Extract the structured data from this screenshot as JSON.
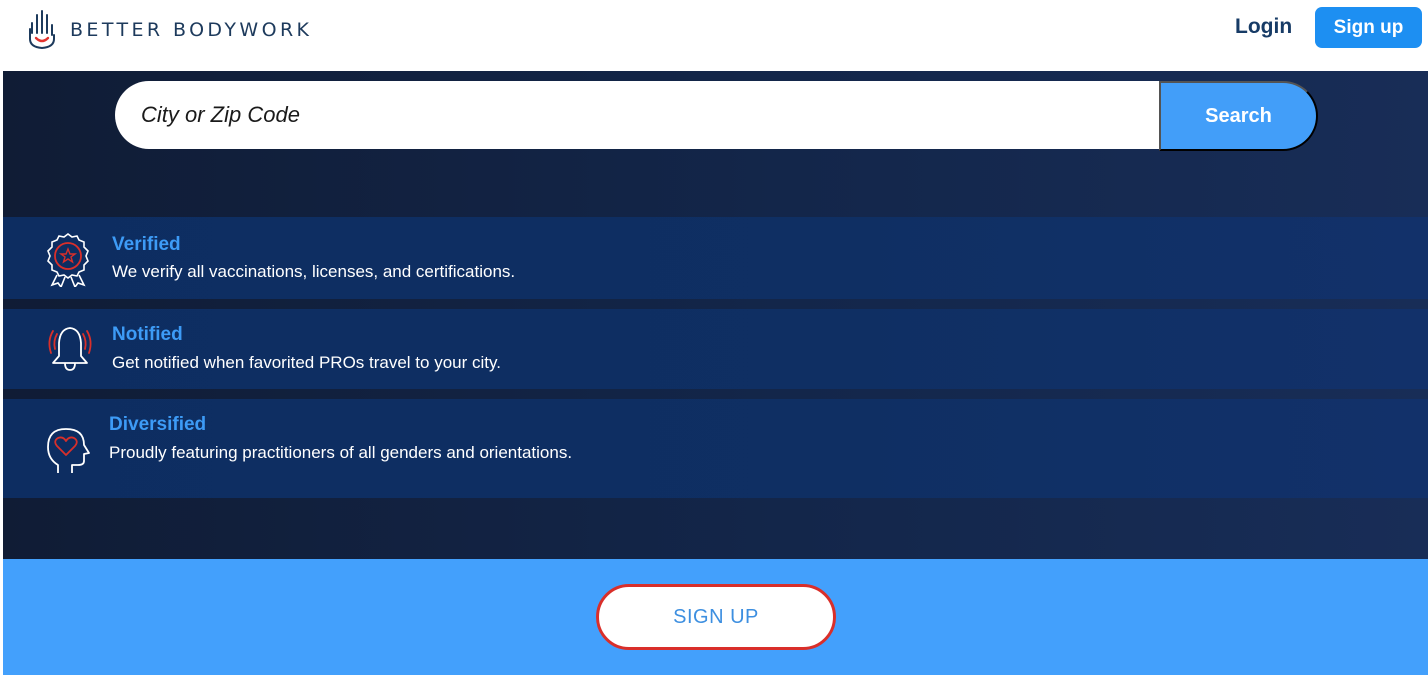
{
  "header": {
    "logo_text": "BETTER BODYWORK",
    "login_label": "Login",
    "signup_label": "Sign up"
  },
  "search": {
    "placeholder": "City or Zip Code",
    "button_label": "Search"
  },
  "features": [
    {
      "title": "Verified",
      "description": "We verify all vaccinations, licenses, and certifications.",
      "icon": "verified-badge-icon"
    },
    {
      "title": "Notified",
      "description": "Get notified when favorited PROs travel to your city.",
      "icon": "bell-icon"
    },
    {
      "title": "Diversified",
      "description": "Proudly featuring practitioners of all genders and orientations.",
      "icon": "head-heart-icon"
    }
  ],
  "cta": {
    "signup_label": "SIGN UP"
  },
  "colors": {
    "accent": "#429ef9",
    "brand_navy": "#173b66",
    "icon_red": "#d92f2a",
    "hero_bg": "#13264a"
  }
}
